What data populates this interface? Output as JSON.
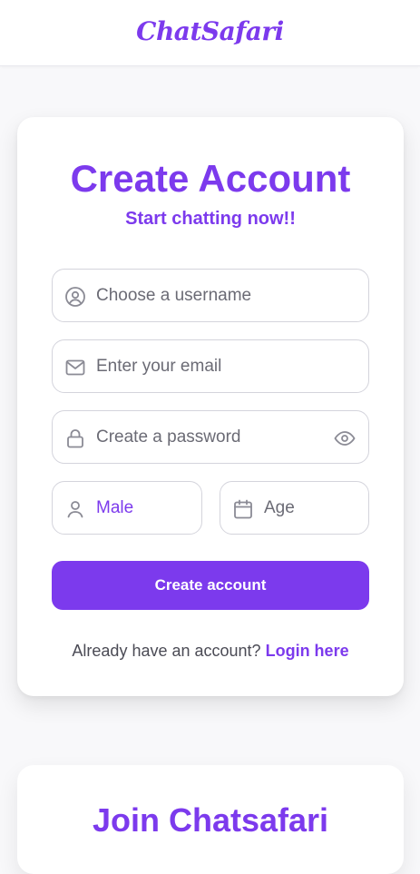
{
  "header": {
    "logo": "ChatSafari"
  },
  "signup": {
    "title": "Create Account",
    "subtitle": "Start chatting now!!",
    "username_placeholder": "Choose a username",
    "email_placeholder": "Enter your email",
    "password_placeholder": "Create a password",
    "gender_value": "Male",
    "age_placeholder": "Age",
    "submit_label": "Create account",
    "login_prompt": "Already have an account?",
    "login_link": "Login here"
  },
  "next_section": {
    "title": "Join Chatsafari"
  },
  "colors": {
    "accent": "#7c3aed",
    "icon_gray": "#8b8b95"
  }
}
